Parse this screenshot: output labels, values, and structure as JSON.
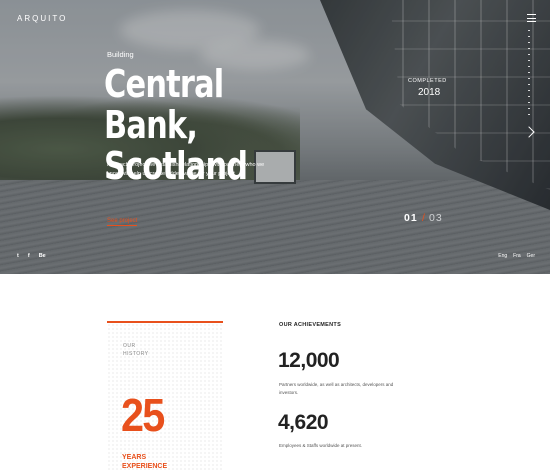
{
  "header": {
    "logo": "ARQUITO",
    "menu_icon": "hamburger-menu-icon"
  },
  "hero": {
    "category": "Building",
    "title_line1": "Central Bank,",
    "title_line2": "Scotland",
    "description": "For each project we establish relationships with partners who we know will help us create added value for your project",
    "cta_label": "See project",
    "completed_label": "COMPLETED",
    "completed_year": "2018",
    "slide_current": "01",
    "slide_separator": "/",
    "slide_total": "03",
    "next_icon": "chevron-right-icon"
  },
  "social": [
    "t",
    "f",
    "Be"
  ],
  "languages": [
    "Eng",
    "Fra",
    "Ger"
  ],
  "history": {
    "label_line1": "OUR",
    "label_line2": "HISTORY",
    "years": "25",
    "caption_line1": "YEARS",
    "caption_line2": "EXPERIENCE"
  },
  "achievements": {
    "title": "OUR ACHIEVEMENTS",
    "stats": [
      {
        "value": "12,000",
        "description": "Partners worldwide, as well as architects, developers and investors."
      },
      {
        "value": "4,620",
        "description": "Employees & Staffs worldwide at present."
      }
    ]
  },
  "colors": {
    "accent": "#e8501c",
    "text_dark": "#222222"
  }
}
